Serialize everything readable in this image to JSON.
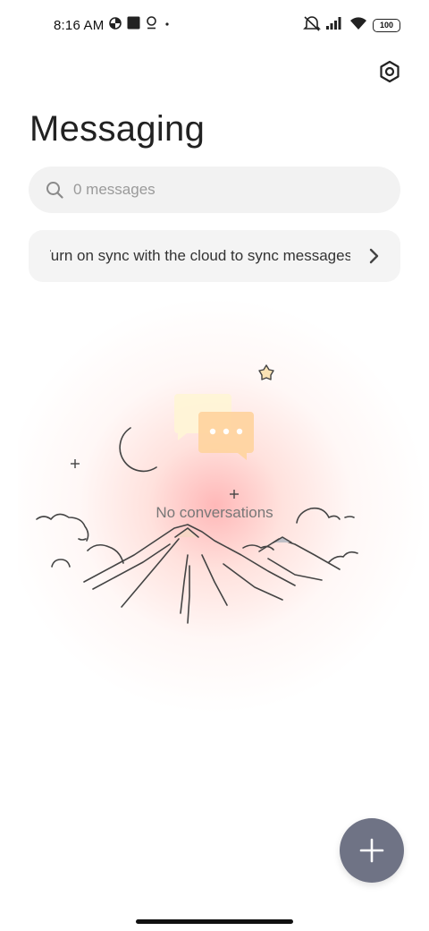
{
  "status_bar": {
    "time": "8:16 AM",
    "battery": "100",
    "left_icons": [
      "data-saver-icon",
      "square-notification-icon",
      "location-icon",
      "dot-icon"
    ],
    "right_icons": [
      "mute-icon",
      "signal-icon",
      "wifi-icon",
      "battery-icon"
    ]
  },
  "header": {
    "title": "Messaging",
    "settings_icon": "settings-icon"
  },
  "search": {
    "placeholder": "0 messages",
    "icon": "search-icon"
  },
  "sync_banner": {
    "text": "Turn on sync with the cloud to sync messages",
    "icon": "chevron-right-icon"
  },
  "empty_state": {
    "label": "No conversations",
    "glow_color": "#ffb3ad",
    "bubble_back_color": "#fff4d6",
    "bubble_front_color": "#ffd8a8"
  },
  "fab": {
    "icon": "plus-icon",
    "color": "#6f7385"
  }
}
